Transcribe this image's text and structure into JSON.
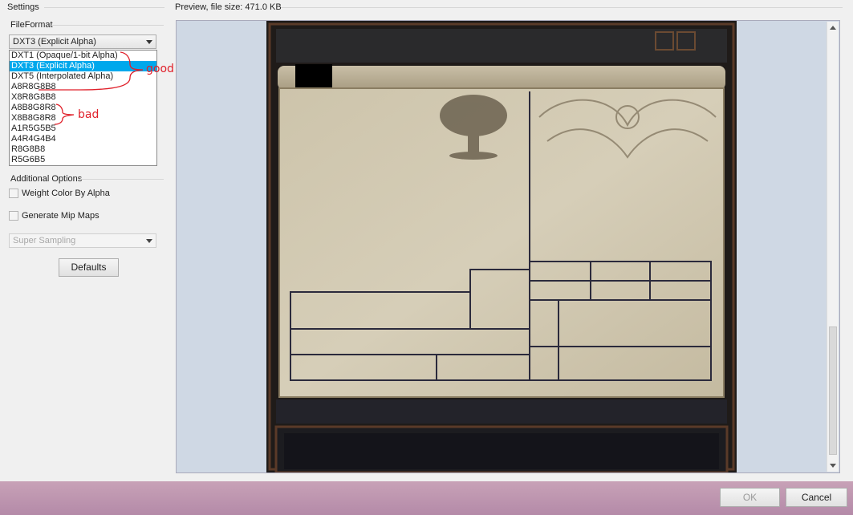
{
  "settings": {
    "title": "Settings",
    "file_format_label": "FileFormat",
    "file_format_selected": "DXT3 (Explicit Alpha)",
    "file_format_options": [
      "DXT1 (Opaque/1-bit Alpha)",
      "DXT3 (Explicit Alpha)",
      "DXT5 (Interpolated Alpha)",
      "A8R8G8B8",
      "X8R8G8B8",
      "A8B8G8R8",
      "X8B8G8R8",
      "A1R5G5B5",
      "A4R4G4B4",
      "R8G8B8",
      "R5G6B5"
    ],
    "selected_index": 1,
    "additional_options_label": "Additional Options",
    "weight_color_label": "Weight Color By Alpha",
    "mip_maps_label": "Generate Mip Maps",
    "mip_filter_selected": "Super Sampling",
    "defaults_button": "Defaults"
  },
  "annotations": {
    "good": "good",
    "bad": "bad",
    "color": "#e0202a"
  },
  "preview": {
    "title": "Preview, file size: 471.0 KB"
  },
  "footer": {
    "ok_button": "OK",
    "cancel_button": "Cancel"
  },
  "colors": {
    "selection": "#00a8ec",
    "parchment": "#cfc6ae",
    "frame_dark": "#1e1a18",
    "preview_bg": "#cfd8e4"
  }
}
